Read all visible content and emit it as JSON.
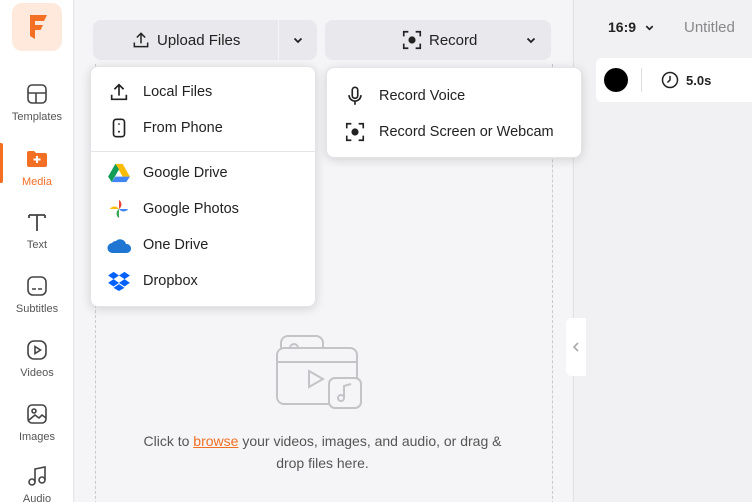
{
  "colors": {
    "accent": "#f36f24"
  },
  "rail": {
    "items": [
      {
        "label": "Templates",
        "icon": "templates-icon"
      },
      {
        "label": "Media",
        "icon": "media-folder-icon",
        "active": true
      },
      {
        "label": "Text",
        "icon": "text-icon"
      },
      {
        "label": "Subtitles",
        "icon": "subtitles-icon"
      },
      {
        "label": "Videos",
        "icon": "videos-icon"
      },
      {
        "label": "Images",
        "icon": "images-icon"
      },
      {
        "label": "Audio",
        "icon": "audio-icon"
      }
    ]
  },
  "toolbar": {
    "upload_label": "Upload Files",
    "record_label": "Record"
  },
  "upload_menu": {
    "items": [
      {
        "label": "Local Files",
        "icon": "upload-icon"
      },
      {
        "label": "From Phone",
        "icon": "phone-icon"
      },
      {
        "label": "Google Drive",
        "icon": "google-drive-icon"
      },
      {
        "label": "Google Photos",
        "icon": "google-photos-icon"
      },
      {
        "label": "One Drive",
        "icon": "onedrive-icon"
      },
      {
        "label": "Dropbox",
        "icon": "dropbox-icon"
      }
    ]
  },
  "record_menu": {
    "items": [
      {
        "label": "Record Voice",
        "icon": "microphone-icon"
      },
      {
        "label": "Record Screen or Webcam",
        "icon": "screen-record-icon"
      }
    ]
  },
  "dropzone": {
    "prefix": "Click to ",
    "link": "browse",
    "suffix": " your videos, images, and audio, or drag & drop files here."
  },
  "project": {
    "ratio": "16:9",
    "title": "Untitled",
    "duration": "5.0s"
  }
}
